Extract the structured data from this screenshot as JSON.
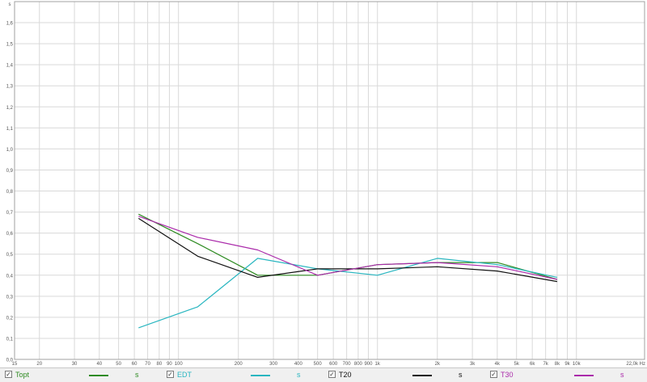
{
  "chart_data": {
    "type": "line",
    "ylabel": "s",
    "xunit": "Hz",
    "x_scale": "log",
    "xlim": [
      15,
      22000
    ],
    "ylim": [
      0,
      1.7
    ],
    "grid": true,
    "y_ticks": [
      "0,0",
      "0,1",
      "0,2",
      "0,3",
      "0,4",
      "0,5",
      "0,6",
      "0,7",
      "0,8",
      "0,9",
      "1,0",
      "1,1",
      "1,2",
      "1,3",
      "1,4",
      "1,5",
      "1,6"
    ],
    "x_ticks": [
      {
        "v": 15,
        "l": "15"
      },
      {
        "v": 20,
        "l": "20"
      },
      {
        "v": 30,
        "l": "30"
      },
      {
        "v": 40,
        "l": "40"
      },
      {
        "v": 50,
        "l": "50"
      },
      {
        "v": 60,
        "l": "60"
      },
      {
        "v": 70,
        "l": "70"
      },
      {
        "v": 80,
        "l": "80"
      },
      {
        "v": 90,
        "l": "90"
      },
      {
        "v": 100,
        "l": "100"
      },
      {
        "v": 200,
        "l": "200"
      },
      {
        "v": 300,
        "l": "300"
      },
      {
        "v": 400,
        "l": "400"
      },
      {
        "v": 500,
        "l": "500"
      },
      {
        "v": 600,
        "l": "600"
      },
      {
        "v": 700,
        "l": "700"
      },
      {
        "v": 800,
        "l": "800"
      },
      {
        "v": 900,
        "l": "900"
      },
      {
        "v": 1000,
        "l": "1k"
      },
      {
        "v": 2000,
        "l": "2k"
      },
      {
        "v": 3000,
        "l": "3k"
      },
      {
        "v": 4000,
        "l": "4k"
      },
      {
        "v": 5000,
        "l": "5k"
      },
      {
        "v": 6000,
        "l": "6k"
      },
      {
        "v": 7000,
        "l": "7k"
      },
      {
        "v": 8000,
        "l": "8k"
      },
      {
        "v": 9000,
        "l": "9k"
      },
      {
        "v": 10000,
        "l": "10k"
      },
      {
        "v": 22000,
        "l": "22,0k Hz"
      }
    ],
    "x": [
      63,
      125,
      250,
      500,
      1000,
      2000,
      4000,
      8000
    ],
    "series": [
      {
        "name": "Topt",
        "color": "#2e8b22",
        "unit": "s",
        "values": [
          0.69,
          0.55,
          0.4,
          0.4,
          0.45,
          0.46,
          0.46,
          0.38
        ]
      },
      {
        "name": "EDT",
        "color": "#29b6c0",
        "unit": "s",
        "values": [
          0.15,
          0.25,
          0.48,
          0.43,
          0.4,
          0.48,
          0.45,
          0.39
        ]
      },
      {
        "name": "T20",
        "color": "#111111",
        "unit": "s",
        "values": [
          0.67,
          0.49,
          0.39,
          0.43,
          0.43,
          0.44,
          0.42,
          0.37
        ]
      },
      {
        "name": "T30",
        "color": "#aa2aaa",
        "unit": "s",
        "values": [
          0.68,
          0.58,
          0.52,
          0.4,
          0.45,
          0.46,
          0.44,
          0.38
        ]
      }
    ]
  }
}
